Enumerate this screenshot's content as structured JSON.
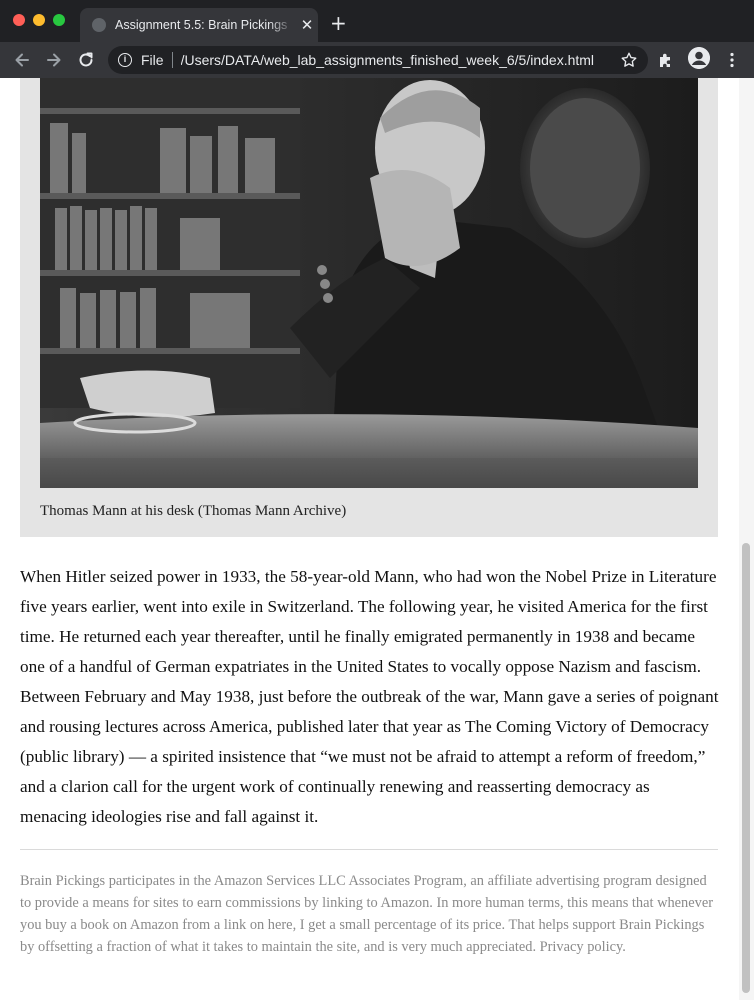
{
  "browser": {
    "tab_title": "Assignment 5.5: Brain Pickings",
    "tab_close": "✕",
    "new_tab": "+",
    "url_scheme": "File",
    "url": "/Users/DATA/web_lab_assignments_finished_week_6/5/index.html"
  },
  "figure": {
    "caption": "Thomas Mann at his desk (Thomas Mann Archive)"
  },
  "article": {
    "paragraph": "When Hitler seized power in 1933, the 58-year-old Mann, who had won the Nobel Prize in Literature five years earlier, went into exile in Switzerland. The following year, he visited America for the first time. He returned each year thereafter, until he finally emigrated permanently in 1938 and became one of a handful of German expatriates in the United States to vocally oppose Nazism and fascism. Between February and May 1938, just before the outbreak of the war, Mann gave a series of poignant and rousing lectures across America, published later that year as The Coming Victory of Democracy (public library) — a spirited insistence that “we must not be afraid to attempt a reform of freedom,” and a clarion call for the urgent work of continually renewing and reasserting democracy as menacing ideologies rise and fall against it."
  },
  "footer": {
    "disclaimer": "Brain Pickings participates in the Amazon Services LLC Associates Program, an affiliate advertising program designed to provide a means for sites to earn commissions by linking to Amazon. In more human terms, this means that whenever you buy a book on Amazon from a link on here, I get a small percentage of its price. That helps support Brain Pickings by offsetting a fraction of what it takes to maintain the site, and is very much appreciated. Privacy policy."
  },
  "icons": {
    "window_controls": [
      "close",
      "minimize",
      "zoom"
    ],
    "toolbar": [
      "back-arrow-icon",
      "forward-arrow-icon",
      "reload-icon",
      "info-icon",
      "star-icon",
      "extensions-icon",
      "profile-icon",
      "menu-icon"
    ]
  },
  "colors": {
    "chrome_dark": "#202124",
    "chrome_toolbar": "#35363a",
    "figure_bg": "#e4e4e4",
    "text": "#111111",
    "muted_text": "#8a8a8a"
  }
}
